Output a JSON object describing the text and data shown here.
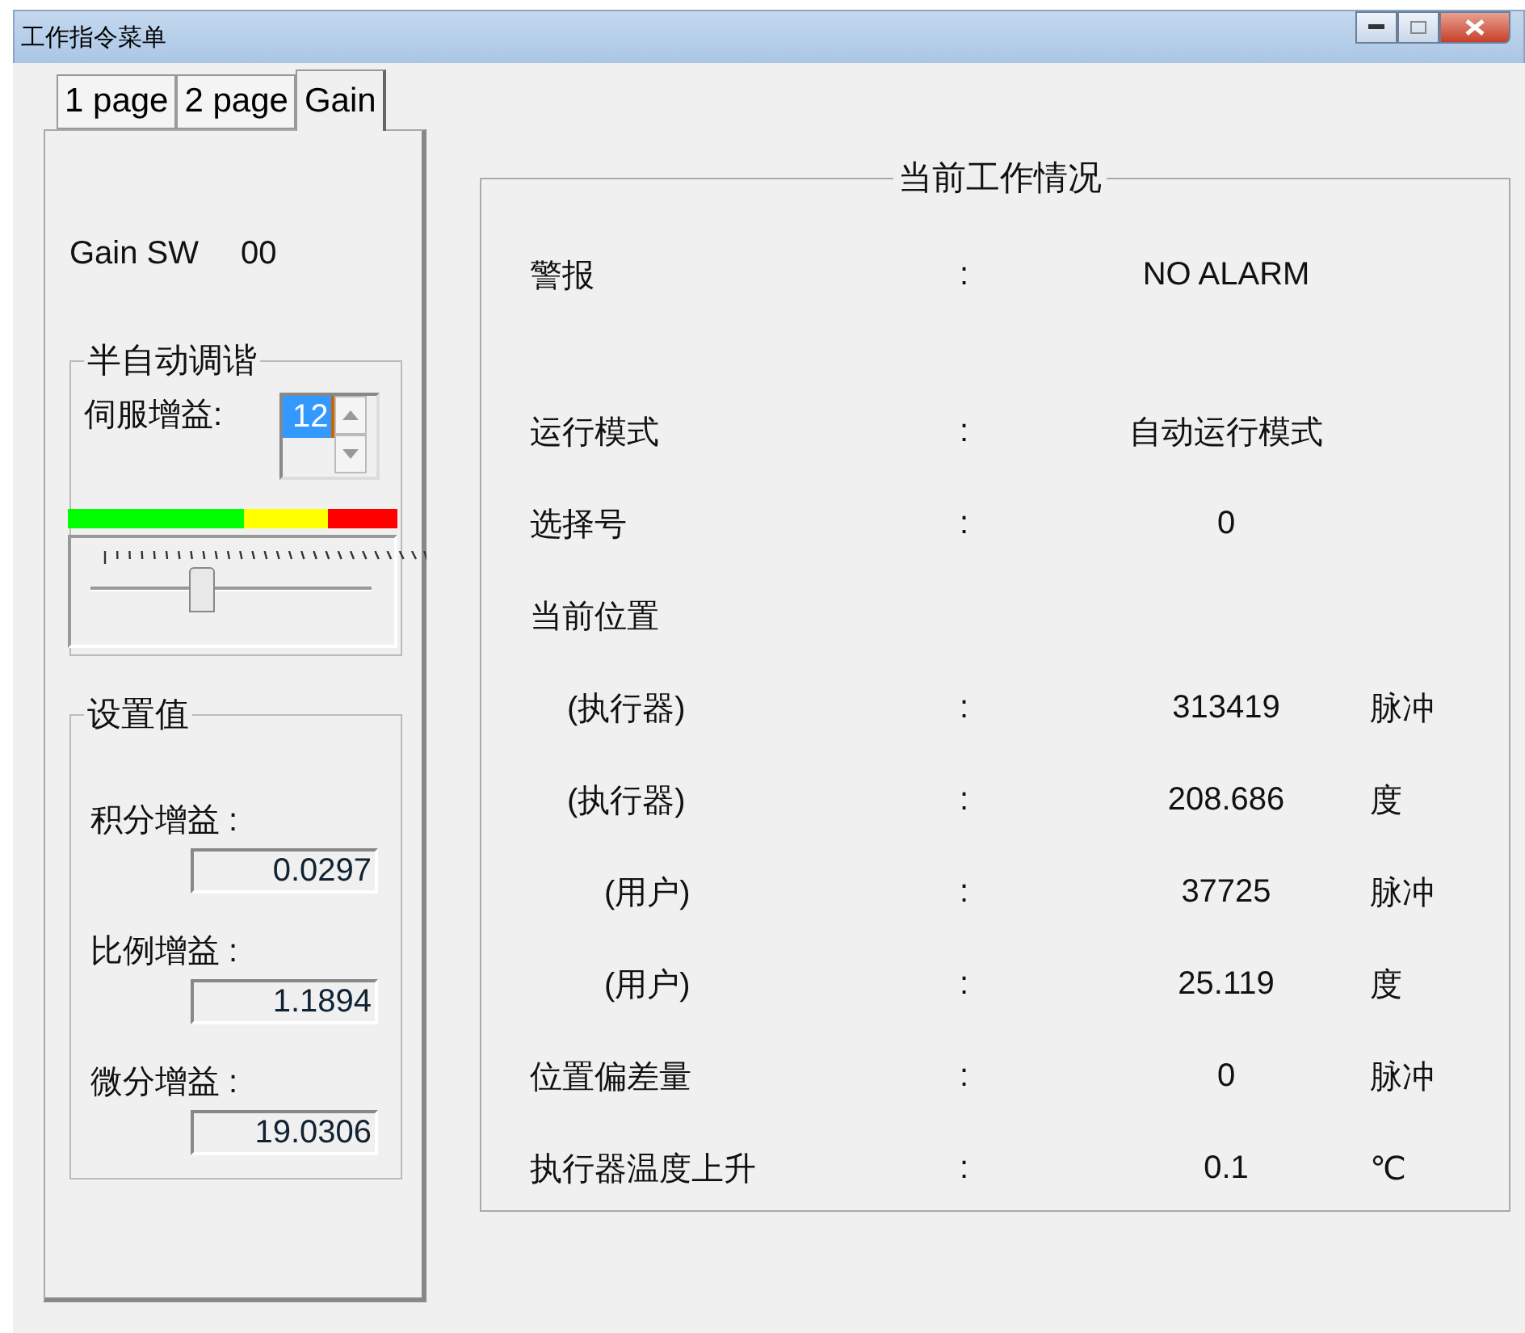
{
  "window": {
    "title": "工作指令菜单"
  },
  "tabs": [
    {
      "label": "1 page",
      "selected": false
    },
    {
      "label": "2 page",
      "selected": false
    },
    {
      "label": "Gain",
      "selected": true
    }
  ],
  "gain_sw": {
    "label": "Gain SW",
    "value": "00"
  },
  "semi_auto": {
    "title": "半自动调谐",
    "servo_gain_label": "伺服增益:",
    "servo_gain_value": "12",
    "slider": {
      "level": 0.39
    }
  },
  "settings": {
    "title": "设置值",
    "fields": [
      {
        "label": "积分增益 :",
        "value": "0.0297"
      },
      {
        "label": "比例增益 :",
        "value": "1.1894"
      },
      {
        "label": "微分增益 :",
        "value": "19.0306"
      }
    ]
  },
  "status": {
    "title": "当前工作情况",
    "rows": [
      {
        "kind": "main",
        "label": "警报",
        "colon": ":",
        "value": "NO ALARM"
      },
      {
        "kind": "main",
        "label": "运行模式",
        "colon": ":",
        "value": "自动运行模式"
      },
      {
        "kind": "main",
        "label": "选择号",
        "colon": ":",
        "value": "0"
      },
      {
        "kind": "main",
        "label": "当前位置",
        "children": [
          {
            "kind": "actuator",
            "label": "(执行器)",
            "colon": ":",
            "value": "313419",
            "unit": "脉冲"
          },
          {
            "kind": "actuator",
            "label": "(执行器)",
            "colon": ":",
            "value": "208.686",
            "unit": "度"
          },
          {
            "kind": "user",
            "label": "(用户)",
            "colon": ":",
            "value": "37725",
            "unit": "脉冲"
          },
          {
            "kind": "user",
            "label": "(用户)",
            "colon": ":",
            "value": "25.119",
            "unit": "度"
          }
        ]
      },
      {
        "kind": "main",
        "label": "位置偏差量",
        "colon": ":",
        "value": "0",
        "unit": "脉冲"
      },
      {
        "kind": "main",
        "label": "执行器温度上升",
        "colon": ":",
        "value": "0.1",
        "unit": "℃"
      }
    ]
  }
}
